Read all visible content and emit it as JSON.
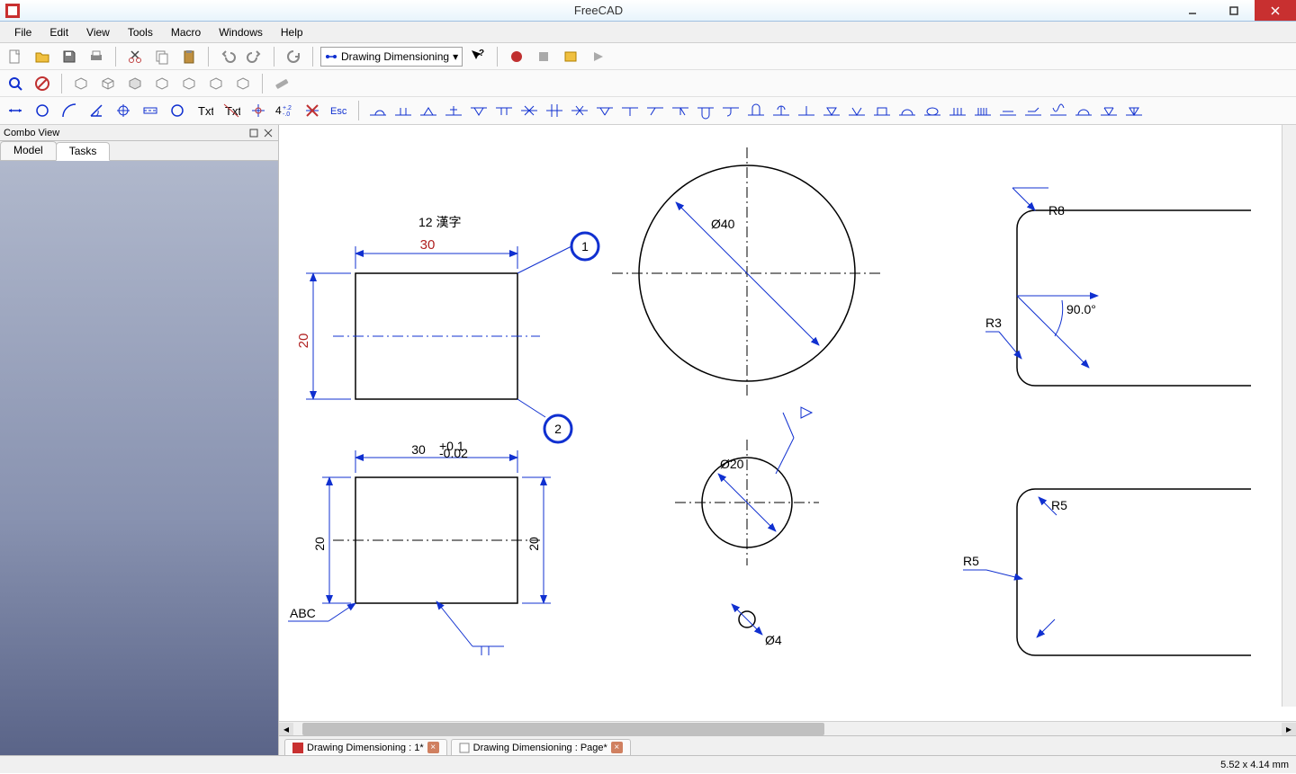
{
  "app": {
    "title": "FreeCAD"
  },
  "menu": {
    "items": [
      "File",
      "Edit",
      "View",
      "Tools",
      "Macro",
      "Windows",
      "Help"
    ]
  },
  "workbench": {
    "selected": "Drawing Dimensioning"
  },
  "combo": {
    "title": "Combo View",
    "tabs": [
      "Model",
      "Tasks"
    ],
    "active": 1
  },
  "docs": [
    {
      "label": "Drawing Dimensioning : 1*"
    },
    {
      "label": "Drawing Dimensioning : Page*"
    }
  ],
  "status": {
    "coords": "5.52 x 4.14 mm"
  },
  "drawing": {
    "rect1_dim_h": "30",
    "rect1_dim_v": "20",
    "rect1_note": "12  漢字",
    "balloon1": "1",
    "balloon2": "2",
    "rect2_dim_h": "30",
    "rect2_tol_upper": "+0.1",
    "rect2_tol_lower": "-0.02",
    "rect2_dim_v_left": "20",
    "rect2_dim_v_right": "20",
    "rect2_note": "ABC",
    "circ1_dia": "Ø40",
    "circ2_dia": "Ø20",
    "circ3_dia": "Ø4",
    "r8": "R8",
    "r3": "R3",
    "r5a": "R5",
    "r5b": "R5",
    "angle": "90.0°"
  }
}
